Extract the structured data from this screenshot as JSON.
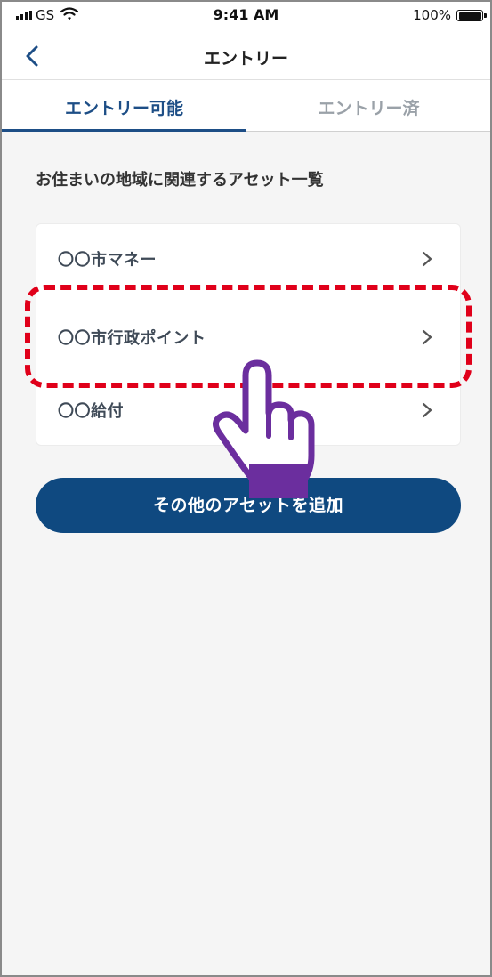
{
  "status_bar": {
    "carrier": "GS",
    "time": "9:41 AM",
    "battery": "100%"
  },
  "nav": {
    "title": "エントリー",
    "back_icon": "chevron-left-icon"
  },
  "tabs": [
    {
      "label": "エントリー可能",
      "active": true
    },
    {
      "label": "エントリー済",
      "active": false
    }
  ],
  "section": {
    "heading": "お住まいの地域に関連するアセット一覧"
  },
  "assets": [
    {
      "label": "〇〇市マネー"
    },
    {
      "label": "〇〇市行政ポイント",
      "highlighted": true
    },
    {
      "label": "〇〇給付"
    }
  ],
  "add_button": {
    "label": "その他のアセットを追加"
  },
  "colors": {
    "accent": "#1d4e86",
    "button": "#0f4980",
    "highlight": "#e0001a",
    "hand": "#6b2e9e"
  }
}
